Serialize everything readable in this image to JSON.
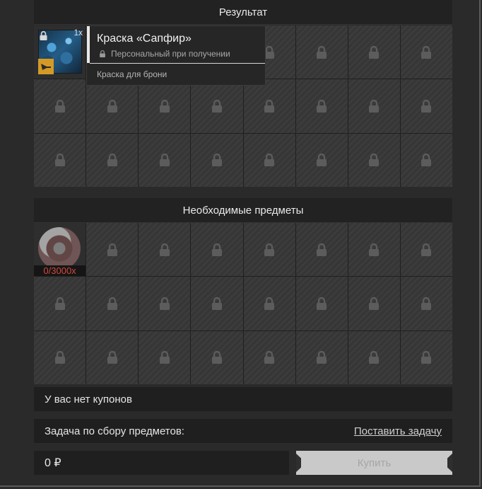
{
  "result": {
    "header": "Результат",
    "item": {
      "quantity": "1x"
    },
    "tooltip": {
      "title": "Краска «Сапфир»",
      "subtitle": "Персональный при получении",
      "description": "Краска для брони"
    }
  },
  "required": {
    "header": "Необходимые предметы",
    "item": {
      "count": "0/3000x"
    }
  },
  "coupons": {
    "text": "У вас нет купонов"
  },
  "task": {
    "label": "Задача по сбору предметов:",
    "link": "Поставить задачу"
  },
  "price": {
    "value": "0 ₽"
  },
  "buy_button": {
    "label": "Купить"
  },
  "colors": {
    "background": "#2a2a2a",
    "panel": "#1f1f1f",
    "count_red": "#d24a3d",
    "badge_orange": "#d49a26"
  },
  "icons": [
    "lock-icon",
    "paint-icon",
    "ammo-badge-icon",
    "token-icon"
  ]
}
